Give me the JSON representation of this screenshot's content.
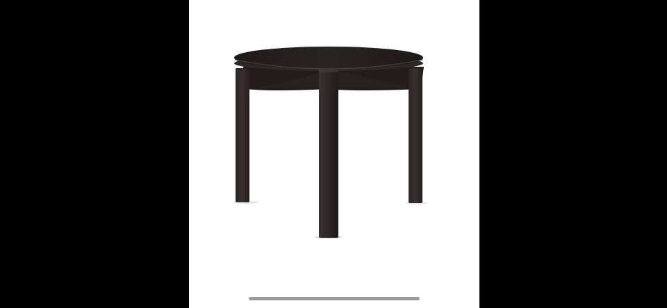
{
  "viewer": {
    "background_color": "#000000",
    "panel_color": "#ffffff",
    "subject_icon": "side-table-photo",
    "wood_color": "#2b2523",
    "top_color": "#241f1e",
    "indicator_color": "#9a9a9a"
  }
}
